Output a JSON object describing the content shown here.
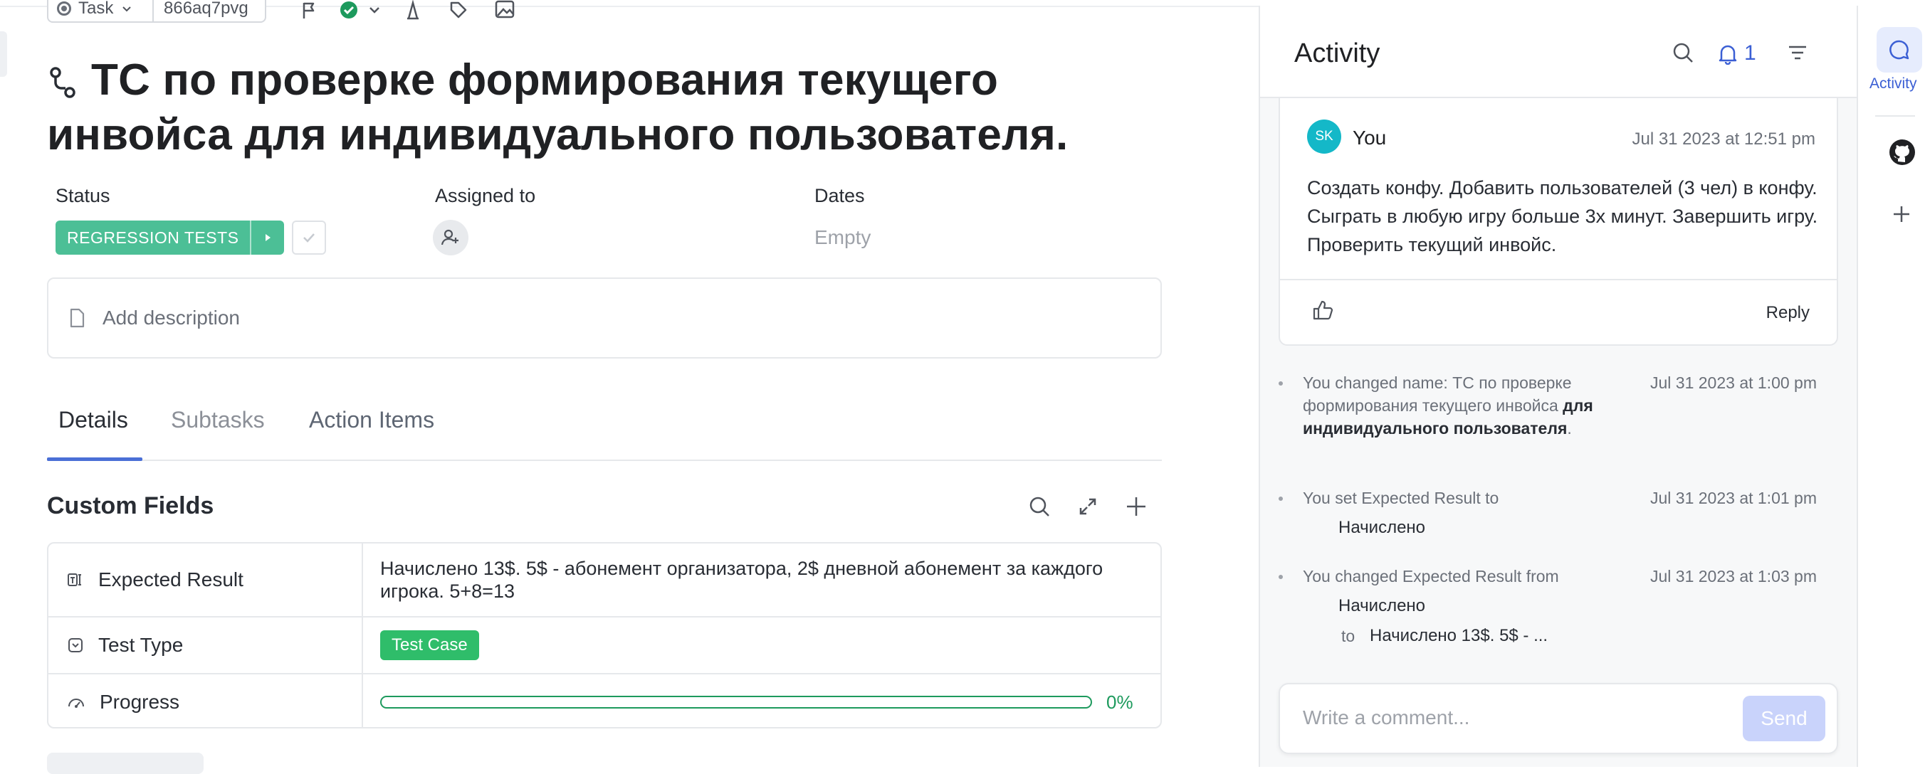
{
  "task": {
    "type_label": "Task",
    "id": "866aq7pvg",
    "title_line1": "ТС по проверке формирования текущего",
    "title_line2": "инвойса для индивидуального пользователя."
  },
  "fields": {
    "status_label": "Status",
    "status_value": "REGRESSION TESTS",
    "assigned_label": "Assigned to",
    "dates_label": "Dates",
    "dates_value": "Empty"
  },
  "description": {
    "placeholder": "Add description"
  },
  "tabs": [
    {
      "label": "Details",
      "active": true
    },
    {
      "label": "Subtasks",
      "active": false
    },
    {
      "label": "Action Items",
      "active": false
    }
  ],
  "custom_fields": {
    "title": "Custom Fields",
    "rows": [
      {
        "icon": "text-field-icon",
        "name": "Expected Result",
        "value": "Начислено 13$. 5$ - абонемент организатора, 2$ дневной абонемент за каждого игрока. 5+8=13"
      },
      {
        "icon": "dropdown-field-icon",
        "name": "Test Type",
        "value": "Test Case",
        "tag_color": "#2fbd6a"
      },
      {
        "icon": "progress-field-icon",
        "name": "Progress",
        "value": "0%",
        "progress": 0
      }
    ]
  },
  "activity": {
    "title": "Activity",
    "notification_count": "1",
    "comment": {
      "avatar_initials": "SK",
      "author": "You",
      "time": "Jul 31 2023 at 12:51 pm",
      "body": "Создать конфу. Добавить пользователей (3 чел) в конфу. Сыграть в любую игру больше 3х минут. Завершить игру. Проверить текущий инвойс.",
      "reply_label": "Reply"
    },
    "log": [
      {
        "prefix": "You changed name: ТС по проверке формирования текущего инвойса ",
        "bold": "для индивидуального пользователя",
        "suffix": ".",
        "time": "Jul 31 2023 at 1:00 pm"
      },
      {
        "text": "You set Expected Result to",
        "value": "Начислено",
        "time": "Jul 31 2023 at 1:01 pm"
      },
      {
        "text": "You changed Expected Result from",
        "from": "Начислено",
        "to_word": "to",
        "to": "Начислено 13$. 5$ - ...",
        "time": "Jul 31 2023 at 1:03 pm"
      }
    ],
    "comment_placeholder": "Write a comment...",
    "send_label": "Send"
  },
  "rail": {
    "activity_label": "Activity"
  },
  "colors": {
    "accent": "#3b5fd4",
    "status": "#4cbf96",
    "progress": "#1d9a5d",
    "avatar": "#14b8c8"
  }
}
